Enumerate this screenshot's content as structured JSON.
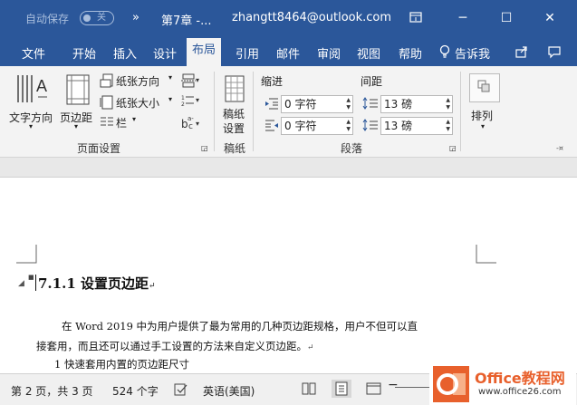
{
  "titlebar": {
    "autosave": "自动保存",
    "autosave_state": "关",
    "qat_more": "»",
    "doc_title": "第7章 -...",
    "account": "zhangtt8464@outlook.com",
    "minimize": "─",
    "maximize": "☐",
    "close": "✕"
  },
  "tabs": [
    "文件",
    "开始",
    "插入",
    "设计",
    "布局",
    "引用",
    "邮件",
    "审阅",
    "视图",
    "帮助"
  ],
  "active_tab": "布局",
  "tell_me": "告诉我",
  "ribbon": {
    "text_direction": "文字方向",
    "margins": "页边距",
    "orientation": "纸张方向",
    "size": "纸张大小",
    "columns": "栏",
    "page_setup_label": "页面设置",
    "draft_label1": "稿纸",
    "draft_label2": "设置",
    "draft_group_label": "稿纸",
    "indent_header": "缩进",
    "spacing_header": "间距",
    "indent_left": "0 字符",
    "indent_right": "0 字符",
    "spacing_before": "13 磅",
    "spacing_after": "13 磅",
    "paragraph_label": "段落",
    "arrange": "排列"
  },
  "document": {
    "heading": "7.1.1  设置页边距",
    "para_line1": "在 Word  2019 中为用户提供了最为常用的几种页边距规格，用户不但可以直",
    "para_line2": "接套用，而且还可以通过手工设置的方法来自定义页边距。",
    "list_line": "1   快速套用内置的页边距尺寸"
  },
  "status": {
    "page": "第 2 页，共 3 页",
    "words": "524 个字",
    "language": "英语(美国)"
  },
  "watermark": {
    "brand": "Office教程网",
    "url": "www.office26.com"
  },
  "colors": {
    "accent": "#2b579a",
    "ribbon_bg": "#f3f3f3",
    "status_bg": "#f0f0f0",
    "watermark_orange": "#e8602c"
  }
}
